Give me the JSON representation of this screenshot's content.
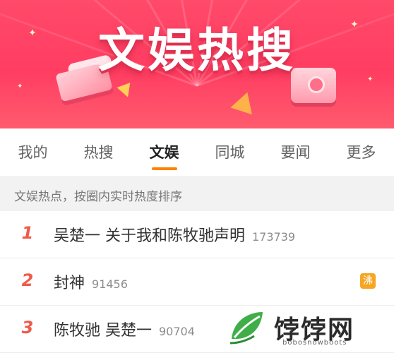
{
  "banner": {
    "title": "文娱热搜",
    "colors": {
      "background": "#ff4065",
      "title_shadow": "#e0304f"
    }
  },
  "tabs": [
    {
      "label": "我的",
      "active": false
    },
    {
      "label": "热搜",
      "active": false
    },
    {
      "label": "文娱",
      "active": true
    },
    {
      "label": "同城",
      "active": false
    },
    {
      "label": "要闻",
      "active": false
    },
    {
      "label": "更多",
      "active": false
    }
  ],
  "info": {
    "text": "文娱热点，按圈内实时热度排序"
  },
  "list": [
    {
      "rank": "1",
      "keyword": "吴楚一 关于我和陈牧驰声明",
      "heat": "173739",
      "badge": ""
    },
    {
      "rank": "2",
      "keyword": "封神",
      "heat": "91456",
      "badge": "沸"
    },
    {
      "rank": "3",
      "keyword": "陈牧驰 吴楚一",
      "heat": "90704",
      "badge": ""
    }
  ],
  "colors": {
    "accent": "#ff8200",
    "rank": "#ef5a4b",
    "badge_hot": "#f5a623"
  },
  "watermark": {
    "text": "饽饽网",
    "url": "bobosnowboots"
  }
}
